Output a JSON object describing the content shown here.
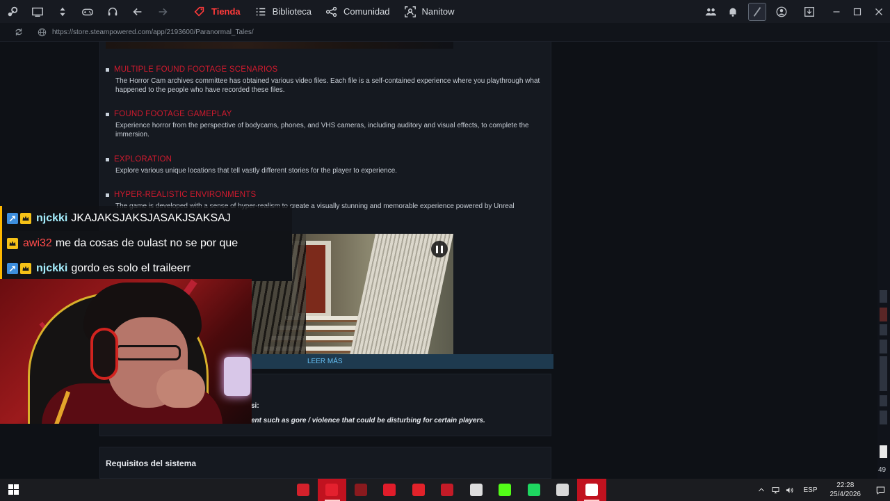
{
  "topbar": {
    "tabs": [
      {
        "label": "Tienda",
        "icon": "tag-icon",
        "active": true
      },
      {
        "label": "Biblioteca",
        "icon": "library-icon",
        "active": false
      },
      {
        "label": "Comunidad",
        "icon": "community-icon",
        "active": false
      },
      {
        "label": "Nanitow",
        "icon": "profile-icon",
        "active": false
      }
    ],
    "accent": "#ff3a3a"
  },
  "urlbar": {
    "url": "https://store.steampowered.com/app/2193600/Paranormal_Tales/"
  },
  "features": [
    {
      "title": "MULTIPLE FOUND FOOTAGE SCENARIOS",
      "desc": "The Horror Cam archives committee has obtained various video files. Each file is a self-contained experience where you playthrough what happened to the people who have recorded these files."
    },
    {
      "title": "FOUND FOOTAGE GAMEPLAY",
      "desc": "Experience horror from the perspective of bodycams, phones, and VHS cameras, including auditory and visual effects, to complete the immersion."
    },
    {
      "title": "EXPLORATION",
      "desc": "Explore various unique locations that tell vastly different stories for the player to experience."
    },
    {
      "title": "HYPER-REALISTIC ENVIRONMENTS",
      "desc": "The game is developed with a sense of hyper-realism to create a visually stunning and memorable experience powered by Unreal"
    }
  ],
  "feature_title_color": "#d11a2e",
  "read_more": "LEER MÁS",
  "notice": {
    "line1": "si:",
    "line2": "ent such as gore / violence that could be disturbing for certain players."
  },
  "sysreq": {
    "title": "Requisitos del sistema"
  },
  "scrollbar": {
    "counter": "49"
  },
  "chat": [
    {
      "user": "njckki",
      "user_color": "#a6f0ff",
      "message": "JKAJAKSJAKSJASAKJSAKSAJ",
      "badges": [
        "arrow-badge-icon",
        "crown-badge-icon"
      ]
    },
    {
      "user": "awi32",
      "user_color": "#ff4b4b",
      "message": "me da cosas de oulast no se por que",
      "badges": [
        "crown-badge-icon"
      ]
    },
    {
      "user": "njckki",
      "user_color": "#a6f0ff",
      "message": "gordo es solo el traileerr",
      "badges": [
        "arrow-badge-icon",
        "crown-badge-icon"
      ]
    }
  ],
  "taskbar": {
    "language": "ESP",
    "time": "22:28",
    "date": "25/4/2026",
    "apps": [
      {
        "icon": "game-app-icon",
        "color": "#d3212b"
      },
      {
        "icon": "opera-gx-icon",
        "color": "#e4202e",
        "active": true
      },
      {
        "icon": "amd-icon",
        "color": "#8a1a1e"
      },
      {
        "icon": "checkmark-app-icon",
        "color": "#e01c2a"
      },
      {
        "icon": "notification-app-icon",
        "color": "#e2222a"
      },
      {
        "icon": "video-app-icon",
        "color": "#c41b27"
      },
      {
        "icon": "speedometer-icon",
        "color": "#dddddd"
      },
      {
        "icon": "kick-icon",
        "color": "#53fc18"
      },
      {
        "icon": "spotify-icon",
        "color": "#1ed760"
      },
      {
        "icon": "rocket-app-icon",
        "color": "#d8d8d8"
      },
      {
        "icon": "steam-icon",
        "color": "#ffffff",
        "active": true
      }
    ]
  }
}
